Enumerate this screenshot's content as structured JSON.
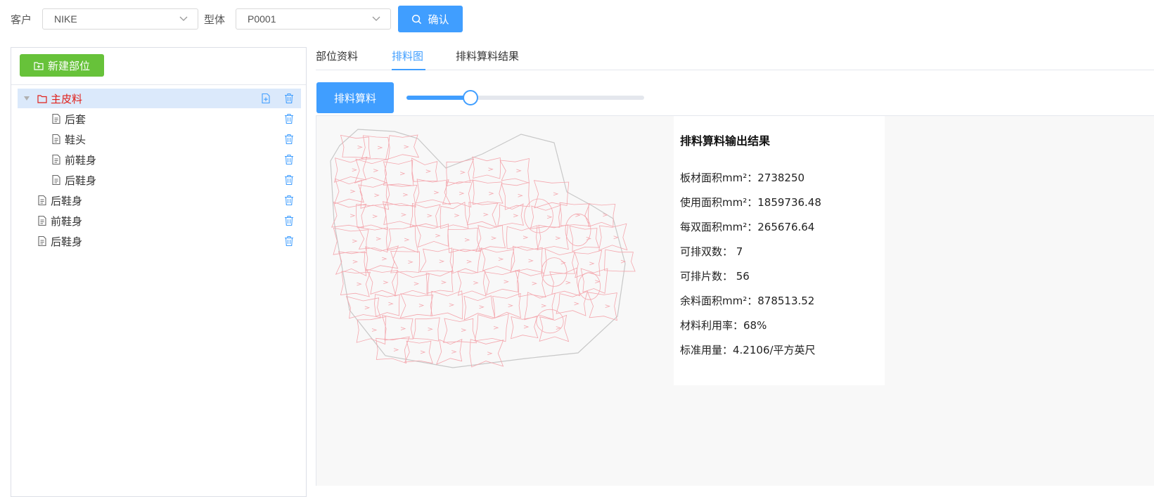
{
  "filters": {
    "customer_label": "客户",
    "customer_value": "NIKE",
    "model_label": "型体",
    "model_value": "P0001",
    "confirm_label": "确认"
  },
  "left": {
    "new_part_label": "新建部位",
    "tree": [
      {
        "label": "主皮料",
        "level": 0,
        "type": "folder",
        "selected": true,
        "expanded": true
      },
      {
        "label": "后套",
        "level": 1,
        "type": "file"
      },
      {
        "label": "鞋头",
        "level": 1,
        "type": "file"
      },
      {
        "label": "前鞋身",
        "level": 1,
        "type": "file"
      },
      {
        "label": "后鞋身",
        "level": 1,
        "type": "file"
      },
      {
        "label": "后鞋身",
        "level": 0,
        "type": "file"
      },
      {
        "label": "前鞋身",
        "level": 0,
        "type": "file"
      },
      {
        "label": "后鞋身",
        "level": 0,
        "type": "file"
      }
    ]
  },
  "tabs": [
    {
      "label": "部位资料",
      "active": false
    },
    {
      "label": "排料图",
      "active": true
    },
    {
      "label": "排料算料结果",
      "active": false
    }
  ],
  "toolbar": {
    "calc_label": "排料算料",
    "slider_value": 0.27
  },
  "result": {
    "title": "排料算料输出结果",
    "lines": [
      "板材面积mm²：2738250",
      "使用面积mm²：1859736.48",
      "每双面积mm²：265676.64",
      "可排双数： 7",
      "可排片数： 56",
      "余料面积mm²：878513.52",
      "材料利用率：68%",
      "标准用量：4.2106/平方英尺"
    ]
  },
  "colors": {
    "primary": "#409eff",
    "success": "#67c23a",
    "selected_text": "#e0201a",
    "piece_outline": "#f4a6ad",
    "sheet_outline": "#c8c8c8"
  }
}
